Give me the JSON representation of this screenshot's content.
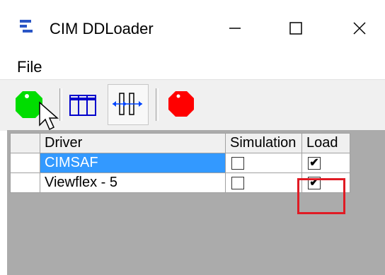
{
  "window": {
    "title": "CIM DDLoader",
    "controls": {
      "minimize": "—",
      "maximize": "☐",
      "close": "✕"
    }
  },
  "menu": {
    "file": "File"
  },
  "toolbar": {
    "buttons": [
      {
        "name": "start",
        "icon": "green-circle-icon",
        "color": "#00dd00"
      },
      {
        "name": "table-view",
        "icon": "table-icon",
        "color": "#0000cc"
      },
      {
        "name": "resize-columns",
        "icon": "split-columns-icon",
        "color": "#0000cc",
        "pressed": true
      },
      {
        "name": "stop",
        "icon": "red-octagon-icon",
        "color": "#ff0000"
      }
    ]
  },
  "grid": {
    "columns": [
      "Driver",
      "Simulation",
      "Load"
    ],
    "rows": [
      {
        "driver": "CIMSAF",
        "simulation": "",
        "load": "✔",
        "selected": true
      },
      {
        "driver": "Viewflex - 5",
        "simulation": "",
        "load": "✔",
        "selected": false
      }
    ]
  },
  "colors": {
    "selection": "#3399ff",
    "highlight": "#e01b24",
    "background": "#ababab"
  }
}
